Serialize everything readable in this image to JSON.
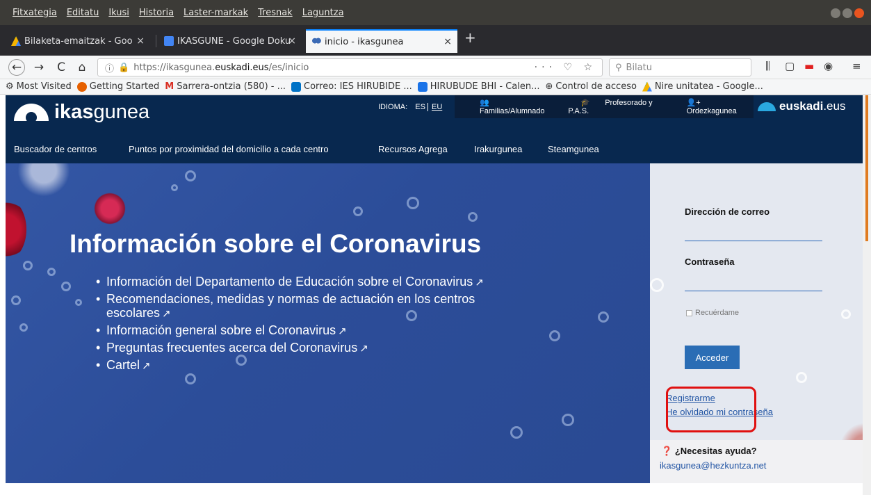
{
  "menu": [
    "Fitxategia",
    "Editatu",
    "Ikusi",
    "Historia",
    "Laster-markak",
    "Tresnak",
    "Laguntza"
  ],
  "tabs": [
    {
      "label": "Bilaketa-emaitzak - Goo",
      "close": "×"
    },
    {
      "label": "IKASGUNE - Google Doku",
      "close": "×"
    },
    {
      "label": "inicio - ikasgunea",
      "close": "×"
    }
  ],
  "newtab": "+",
  "nav": {
    "back": "←",
    "forward": "→",
    "reload": "C",
    "home": "⌂",
    "url_prefix": "https://ikasgunea.",
    "url_domain": "euskadi.eus",
    "url_path": "/es/inicio",
    "url_actions": "··· ♡ ☆",
    "search_placeholder": "Bilatu"
  },
  "bookmarks": [
    {
      "label": "Most Visited",
      "color": "#888888"
    },
    {
      "label": "Getting Started",
      "color": "#e66000"
    },
    {
      "label": "Sarrera-ontzia (580) - ...",
      "color": "#d93025"
    },
    {
      "label": "Correo: IES HIRUBIDE ...",
      "color": "#0072c6"
    },
    {
      "label": "HIRUBUDE BHI - Calen...",
      "color": "#1a73e8"
    },
    {
      "label": "Control de acceso",
      "color": "#555555"
    },
    {
      "label": "Nire unitatea - Google...",
      "color": "#f4b400"
    }
  ],
  "header": {
    "logo_bold": "ikas",
    "logo_light": "gunea",
    "idioma_label": "IDIOMA:",
    "lang_es": "ES",
    "lang_eu": "EU",
    "profiles": [
      "Familias/Alumnado",
      "Profesorado y P.A.S.",
      "Ordezkagunea"
    ],
    "euskadi_bold": "euskadi",
    "euskadi_light": ".eus",
    "mainnav": [
      "Buscador de centros",
      "Puntos por proximidad del domicilio a cada centro",
      "Recursos Agrega",
      "Irakurgunea",
      "Steamgunea"
    ]
  },
  "hero": {
    "title": "Información sobre el Coronavirus",
    "items": [
      "Información del Departamento de Educación sobre el Coronavirus",
      "Recomendaciones, medidas y normas de actuación en los centros escolares",
      "Información general sobre el Coronavirus",
      "Preguntas frecuentes acerca del Coronavirus",
      "Cartel"
    ]
  },
  "login": {
    "email_label": "Dirección de correo",
    "password_label": "Contraseña",
    "remember_label": "Recuérdame",
    "submit_label": "Acceder",
    "register_link": "Registrarme",
    "forgot_link": "He olvidado mi contraseña",
    "help_title": "¿Necesitas ayuda?",
    "help_email": "ikasgunea@hezkuntza.net"
  },
  "colors": {
    "header_bg": "#08284f",
    "hero_bg": "#2c4d99",
    "accent_button": "#2a6db5",
    "highlight_box": "#e01010"
  }
}
